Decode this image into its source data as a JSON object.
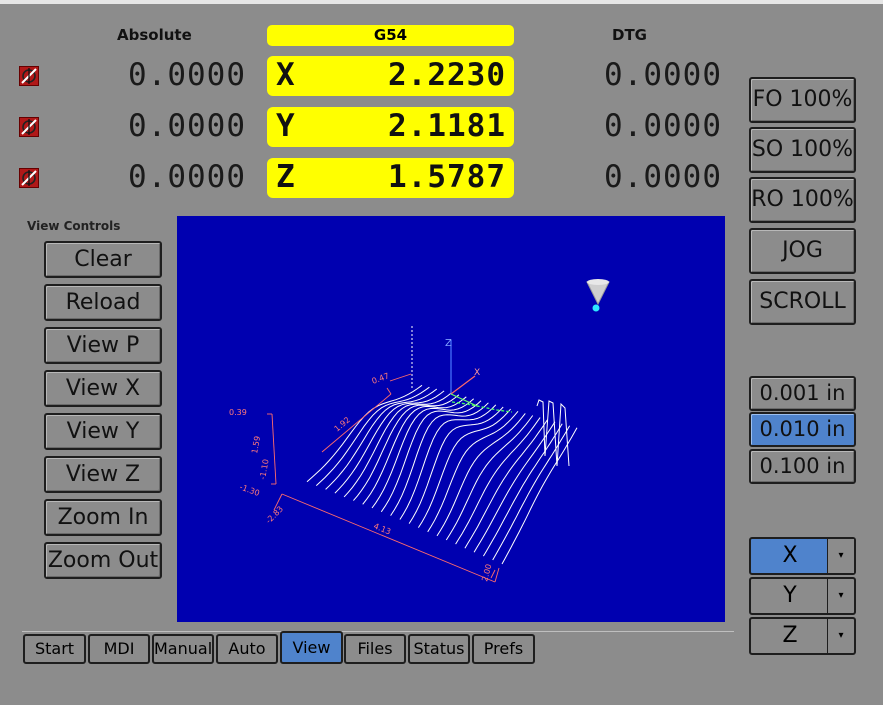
{
  "header": {
    "absolute_label": "Absolute",
    "coord_system": "G54",
    "dtg_label": "DTG"
  },
  "axes": [
    {
      "axis": "X",
      "absolute": "0.0000",
      "relative": "2.2230",
      "dtg": "0.0000",
      "home_icon": "unhomed-icon"
    },
    {
      "axis": "Y",
      "absolute": "0.0000",
      "relative": "2.1181",
      "dtg": "0.0000",
      "home_icon": "unhomed-icon"
    },
    {
      "axis": "Z",
      "absolute": "0.0000",
      "relative": "1.5787",
      "dtg": "0.0000",
      "home_icon": "unhomed-icon"
    }
  ],
  "view_controls": {
    "title": "View Controls",
    "buttons": [
      "Clear",
      "Reload",
      "View P",
      "View X",
      "View Y",
      "View Z",
      "Zoom In",
      "Zoom Out"
    ]
  },
  "overrides": {
    "feed": "FO 100%",
    "spindle": "SO 100%",
    "rapid": "RO 100%",
    "jog": "JOG",
    "scroll": "SCROLL"
  },
  "increments": {
    "options": [
      "0.001 in",
      "0.010 in",
      "0.100 in"
    ],
    "selected": "0.010 in"
  },
  "jog_axes": {
    "options": [
      "X",
      "Y",
      "Z"
    ],
    "selected": "X",
    "dropdown_glyph": "▾"
  },
  "preview": {
    "background": "#0000b0",
    "labels": {
      "axis_z": "Z",
      "axis_x": "X",
      "axis_y": "Y",
      "z_top": "0.39",
      "z_mid1": "1.59",
      "z_mid2": "-1.10",
      "z_bot": "-1.30",
      "y_dim": "1.92",
      "x_dim": "4.13",
      "x_start": "-2.83",
      "x_end": "2.00",
      "corner": "0.47"
    },
    "tool_icon": "tool-cone-icon"
  },
  "tabs": {
    "items": [
      "Start",
      "MDI",
      "Manual",
      "Auto",
      "View",
      "Files",
      "Status",
      "Prefs"
    ],
    "selected": "View"
  },
  "colors": {
    "dro_highlight": "#ffff00",
    "active_button": "#4f83cc",
    "panel": "#8c8c8c"
  }
}
